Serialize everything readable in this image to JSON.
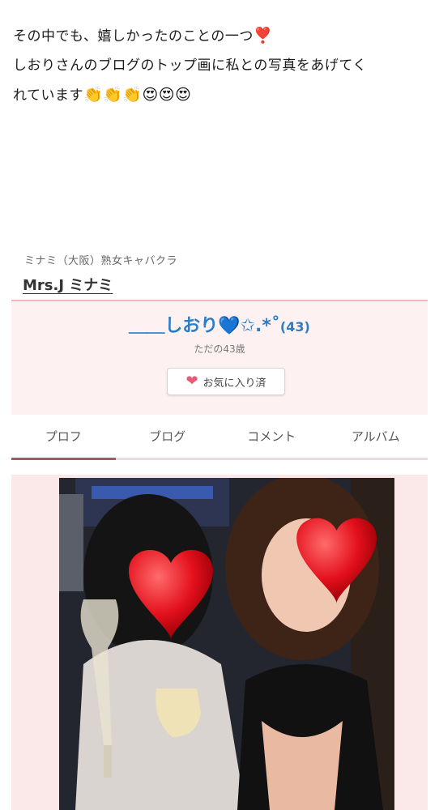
{
  "intro": {
    "line1": "その中でも、嬉しかったのことの一つ",
    "line1_emoji": "❣️",
    "line2": "しおりさんのブログのトップ画に私との写真をあげてく",
    "line3": "れています",
    "line3_emojis": "👏👏👏😍😍😍"
  },
  "shop": {
    "subtitle": "ミナミ（大阪）熟女キャバクラ",
    "name": "Mrs.J ミナミ"
  },
  "profile": {
    "name": "＿＿しおり💙✩.*˚",
    "age_badge": "(43)",
    "age_text": "ただの43歳",
    "favorite_label": "お気に入り済"
  },
  "tabs": [
    {
      "label": "プロフ",
      "active": true
    },
    {
      "label": "ブログ",
      "active": false
    },
    {
      "label": "コメント",
      "active": false
    },
    {
      "label": "アルバム",
      "active": false
    }
  ],
  "colors": {
    "accent_blue": "#2a7ec8",
    "tab_active": "#a05a63",
    "card_bg": "#fdf1f2",
    "heart": "#e95a76"
  },
  "icons": {
    "favorite": "heart-icon",
    "face_cover": "red-heart-sticker"
  }
}
